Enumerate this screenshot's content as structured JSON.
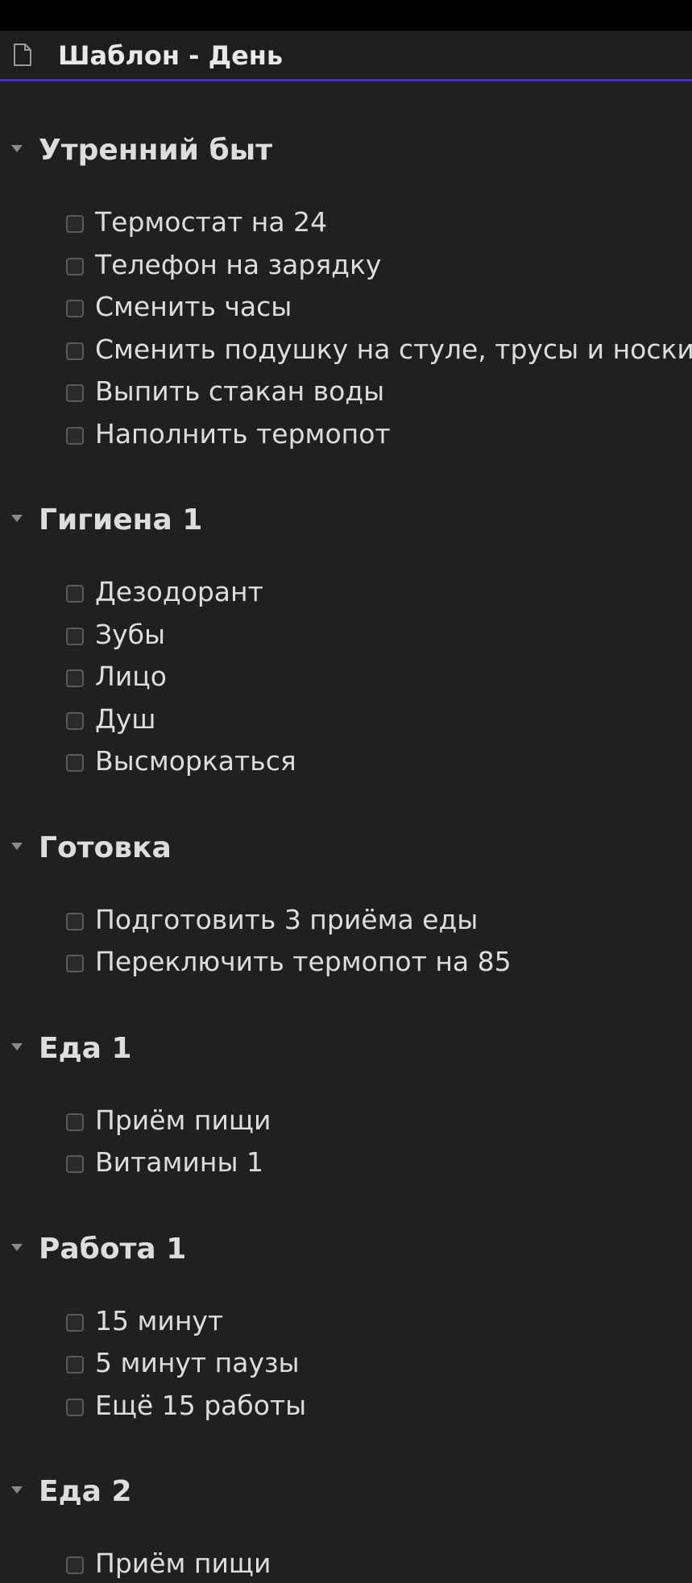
{
  "note": {
    "title": "Шаблон - День",
    "icon": "file-icon"
  },
  "colors": {
    "background": "#202020",
    "accent": "#483699",
    "text": "#dcddde"
  },
  "sections": [
    {
      "heading": "Утренний быт",
      "items": [
        "Термостат на 24",
        "Телефон на зарядку",
        "Сменить часы",
        "Сменить подушку на стуле, трусы и носки",
        "Выпить стакан воды",
        "Наполнить термопот"
      ]
    },
    {
      "heading": "Гигиена 1",
      "items": [
        "Дезодорант",
        "Зубы",
        "Лицо",
        "Душ",
        "Высморкаться"
      ]
    },
    {
      "heading": "Готовка",
      "items": [
        "Подготовить 3 приёма еды",
        "Переключить термопот на 85"
      ]
    },
    {
      "heading": "Еда 1",
      "items": [
        "Приём пищи",
        "Витамины 1"
      ]
    },
    {
      "heading": "Работа 1",
      "items": [
        "15 минут",
        "5 минут паузы",
        "Ещё 15 работы"
      ]
    },
    {
      "heading": "Еда 2",
      "items": [
        "Приём пищи"
      ]
    }
  ]
}
